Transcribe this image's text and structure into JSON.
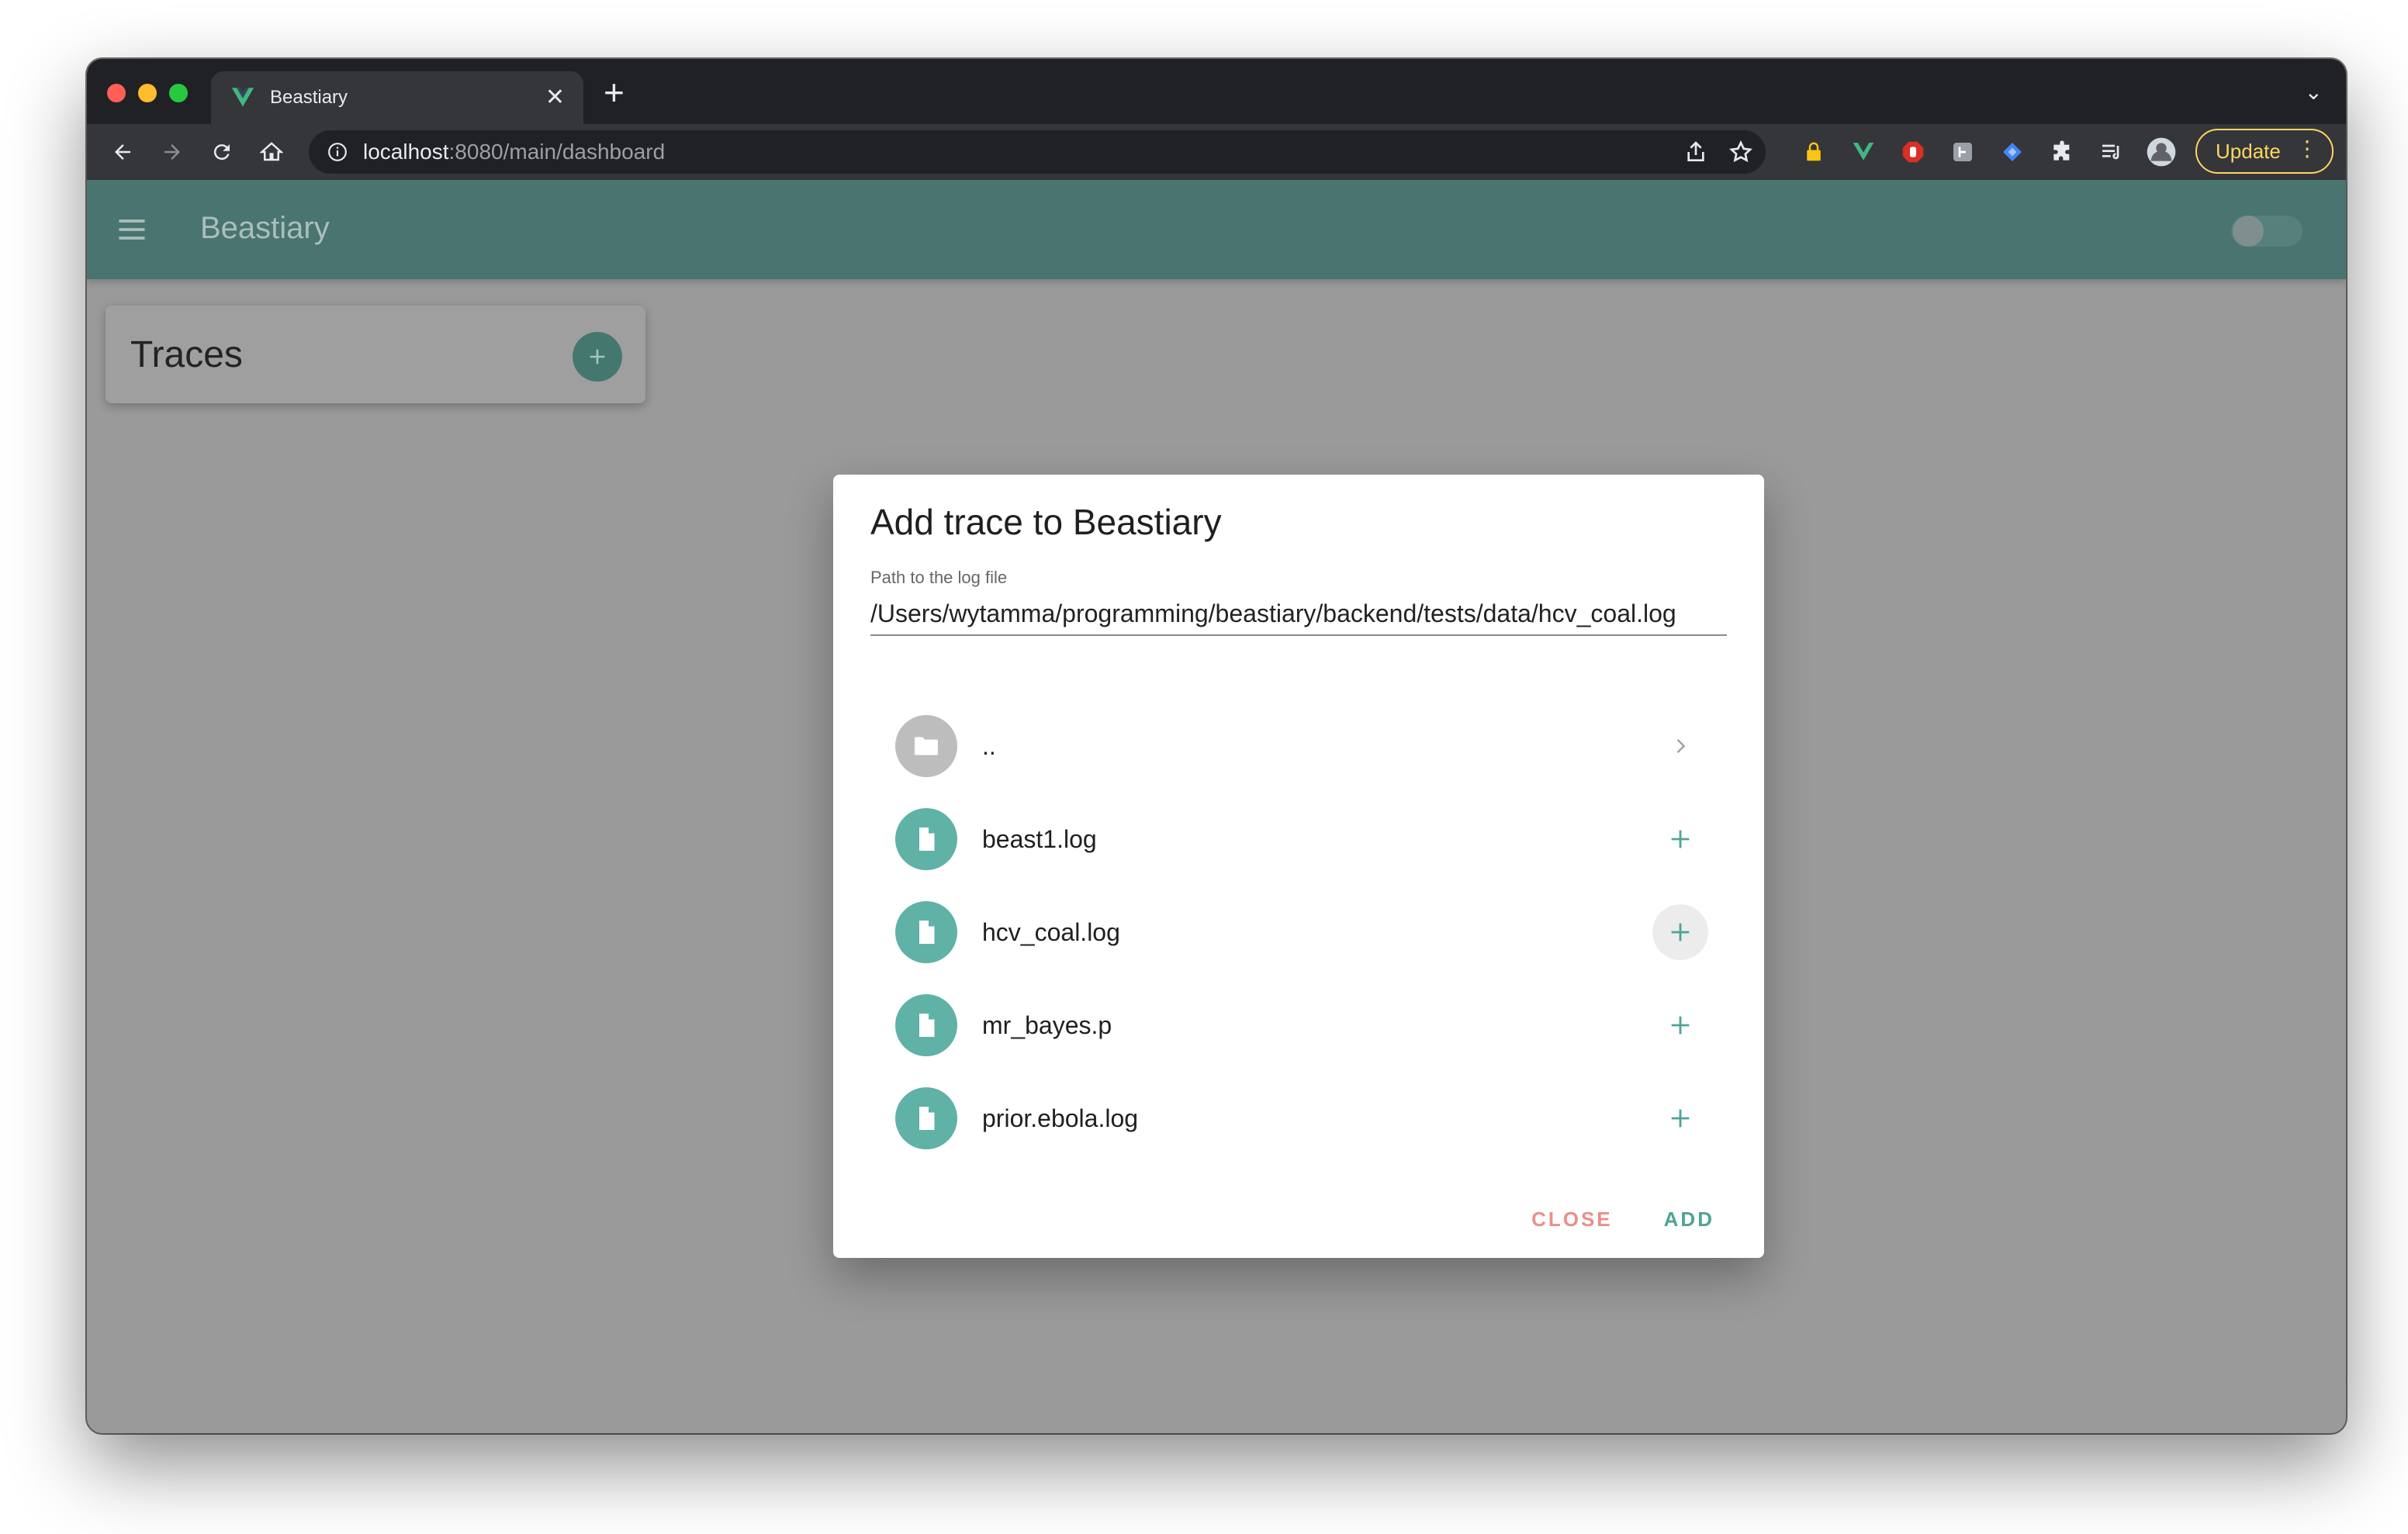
{
  "browser": {
    "tab_title": "Beastiary",
    "url_host": "localhost",
    "url_path": ":8080/main/dashboard",
    "update_label": "Update"
  },
  "app": {
    "title": "Beastiary",
    "accent_color": "#4a7470"
  },
  "traces_card": {
    "title": "Traces"
  },
  "dialog": {
    "title": "Add trace to Beastiary",
    "path_label": "Path to the log file",
    "path_value": "/Users/wytamma/programming/beastiary/backend/tests/data/hcv_coal.log",
    "items": [
      {
        "name": "..",
        "kind": "folder",
        "action_icon": "chevron-right-icon"
      },
      {
        "name": "beast1.log",
        "kind": "file",
        "action_icon": "plus-icon"
      },
      {
        "name": "hcv_coal.log",
        "kind": "file",
        "action_icon": "plus-icon"
      },
      {
        "name": "mr_bayes.p",
        "kind": "file",
        "action_icon": "plus-icon"
      },
      {
        "name": "prior.ebola.log",
        "kind": "file",
        "action_icon": "plus-icon"
      }
    ],
    "close_label": "CLOSE",
    "add_label": "ADD"
  }
}
